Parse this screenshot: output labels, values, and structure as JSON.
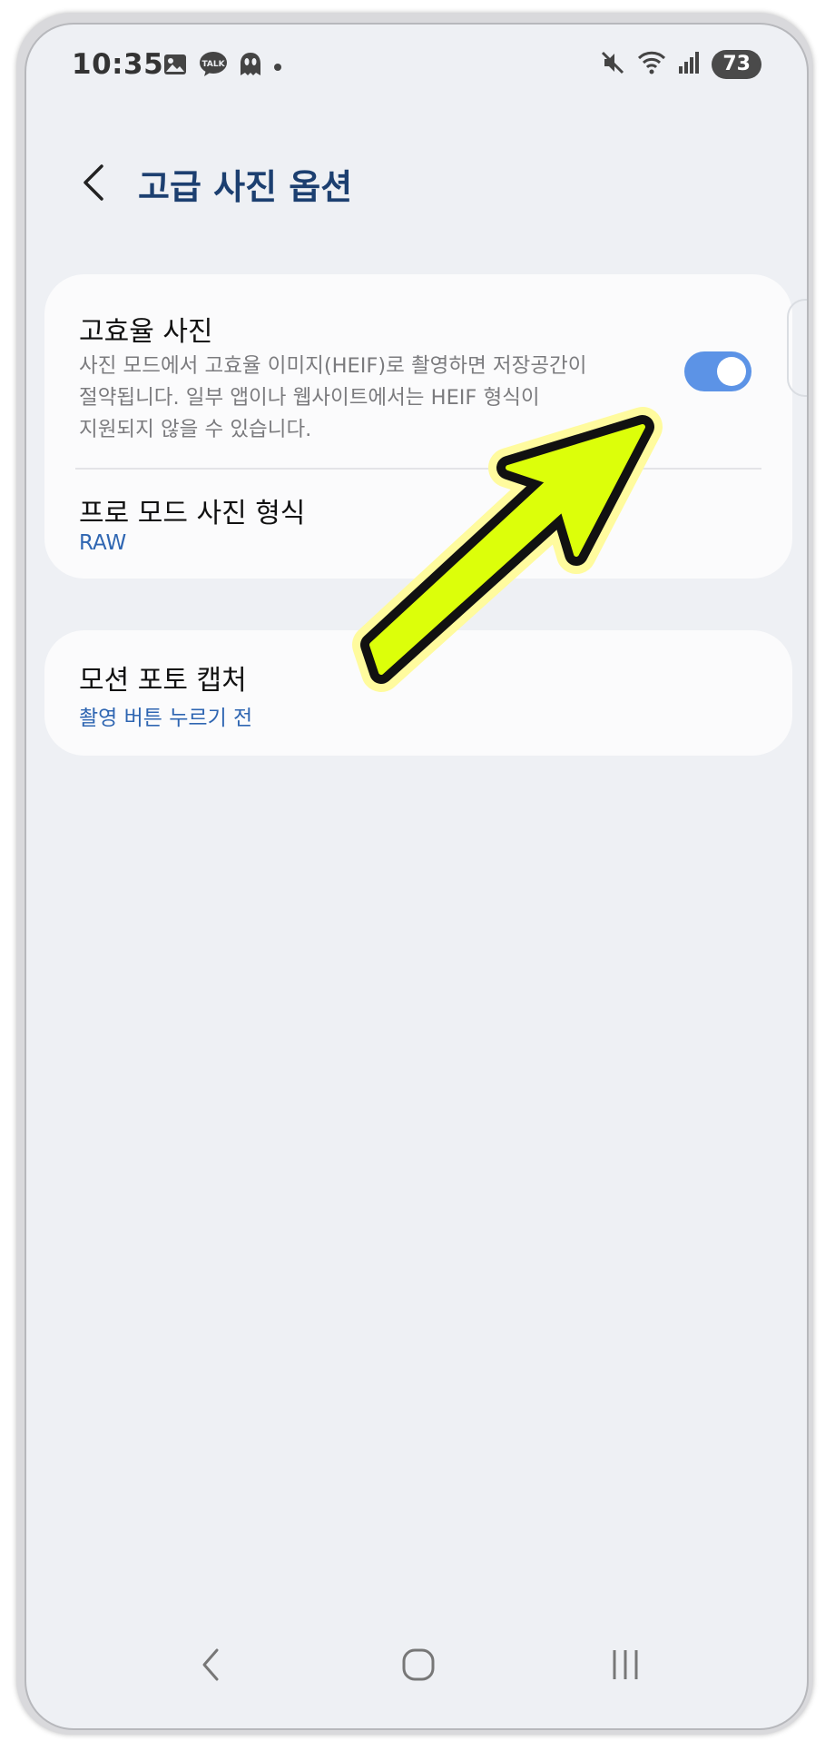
{
  "status_bar": {
    "time": "10:35",
    "battery": "73",
    "left_icons": [
      "image-icon",
      "talk-icon",
      "alien-icon",
      "dot-icon"
    ],
    "right_icons": [
      "mute-icon",
      "wifi-icon",
      "signal-icon"
    ],
    "talk_label": "TALK"
  },
  "header": {
    "title": "고급 사진 옵션"
  },
  "settings": {
    "heif": {
      "title": "고효율 사진",
      "description_line1": "사진 모드에서 고효율 이미지(HEIF)로 촬영하면 저장공간이",
      "description_line2": "절약됩니다. 일부 앱이나 웹사이트에서는 HEIF 형식이",
      "description_line3": "지원되지 않을 수 있습니다.",
      "toggle_on": true
    },
    "pro_mode_format": {
      "title": "프로 모드 사진 형식",
      "value": "RAW"
    },
    "motion_photo": {
      "title": "모션 포토 캡처",
      "value": "촬영 버튼 누르기 전"
    }
  },
  "nav_bar": {
    "buttons": [
      "back-icon",
      "home-icon",
      "recents-icon"
    ]
  },
  "colors": {
    "accent": "#5c93e6",
    "title": "#1c3f70",
    "value_text": "#2f66b2",
    "annotation_fill": "#dcff0a"
  }
}
